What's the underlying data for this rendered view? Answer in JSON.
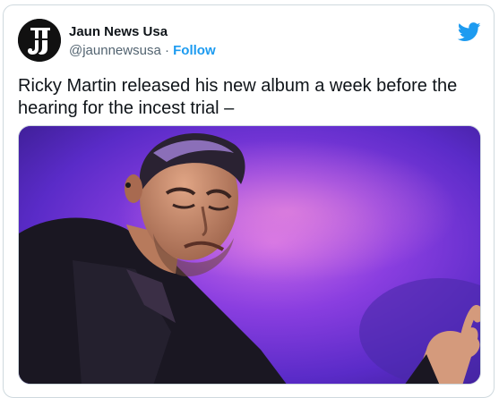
{
  "tweet": {
    "author_name": "Jaun News Usa",
    "author_handle": "@jaunnewsusa",
    "separator": "·",
    "follow_label": "Follow",
    "text": "Ricky Martin released his new album a week before the hearing for the incest trial –",
    "avatar_monogram": "JJ",
    "media": {
      "kind": "photo",
      "subject": "man-performing-on-stage"
    }
  },
  "colors": {
    "accent": "#1d9bf0",
    "text_primary": "#0f1419",
    "text_secondary": "#536471",
    "border": "#cfd9de",
    "photo_background": "#7a3fd6"
  },
  "icons": {
    "platform": "twitter-bird-icon"
  }
}
